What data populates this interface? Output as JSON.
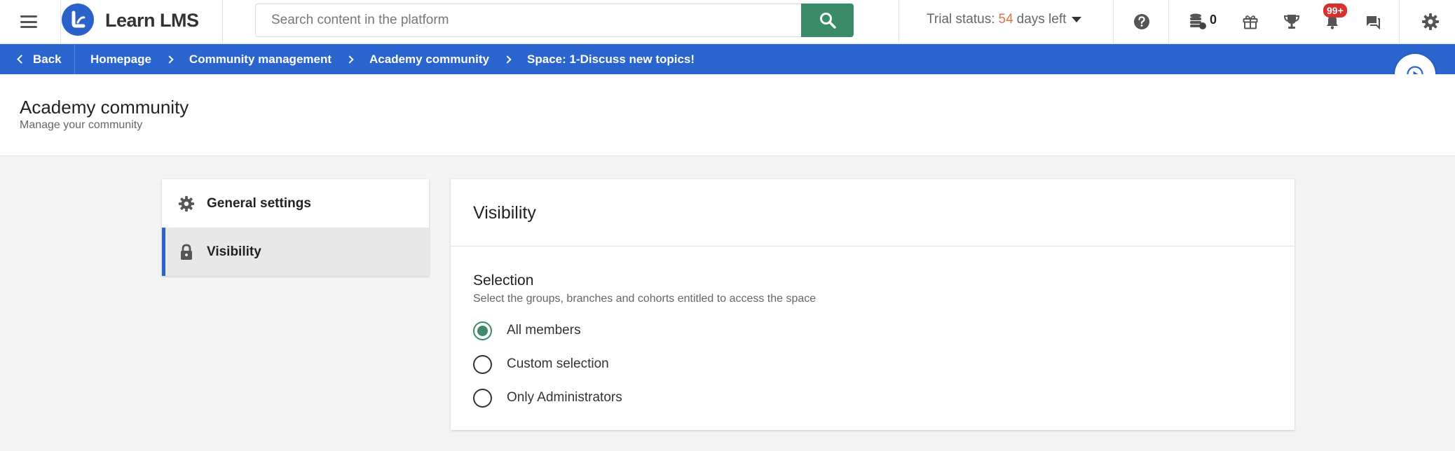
{
  "app": {
    "brand": "Learn LMS"
  },
  "colors": {
    "primary_blue": "#2a64cf",
    "accent_green": "#3b8a68",
    "trial_days": "#e0734a",
    "badge_red": "#d9302c"
  },
  "topbar": {
    "search": {
      "placeholder": "Search content in the platform",
      "value": ""
    },
    "trial": {
      "prefix": "Trial status:",
      "days": "54",
      "suffix": "days left"
    },
    "coins": "0",
    "notifications_badge": "99+",
    "icons": [
      "menu-icon",
      "search-icon",
      "help-icon",
      "coins-icon",
      "gift-icon",
      "trophy-icon",
      "bell-icon",
      "chat-icon",
      "gear-icon"
    ]
  },
  "breadcrumb": {
    "back": "Back",
    "items": [
      "Homepage",
      "Community management",
      "Academy community",
      "Space: 1-Discuss new topics!"
    ]
  },
  "header": {
    "title": "Academy community",
    "subtitle": "Manage your community"
  },
  "sidebar": {
    "items": [
      {
        "label": "General settings",
        "icon": "gear-icon",
        "active": false
      },
      {
        "label": "Visibility",
        "icon": "lock-icon",
        "active": true
      }
    ]
  },
  "panel": {
    "title": "Visibility",
    "section": {
      "title": "Selection",
      "description": "Select the groups, branches and cohorts entitled to access the space",
      "selected": "All members",
      "options": [
        "All members",
        "Custom selection",
        "Only Administrators"
      ]
    }
  }
}
